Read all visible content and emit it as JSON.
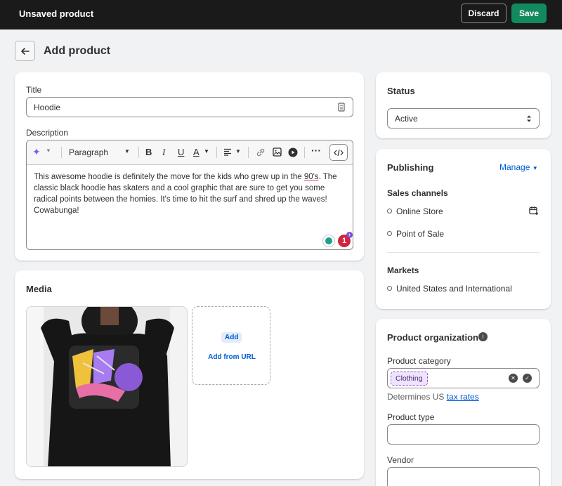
{
  "topbar": {
    "title": "Unsaved product",
    "discard_label": "Discard",
    "save_label": "Save"
  },
  "page": {
    "title": "Add product"
  },
  "product": {
    "title_label": "Title",
    "title_value": "Hoodie",
    "description_label": "Description",
    "toolbar": {
      "paragraph_label": "Paragraph"
    },
    "description": {
      "part1": "This awesome hoodie is definitely the move for the kids who grew up in the ",
      "highlight": "90's",
      "part2": ". The classic black hoodie has skaters and a cool graphic that are sure to get you some radical points between the homies. It's time to hit the surf and shred up the waves! Cowabunga!"
    },
    "grammar_badge_count": "1"
  },
  "media": {
    "heading": "Media",
    "add_label": "Add",
    "add_from_url_label": "Add from URL"
  },
  "status": {
    "heading": "Status",
    "selected": "Active"
  },
  "publishing": {
    "heading": "Publishing",
    "manage_label": "Manage",
    "sales_channels_label": "Sales channels",
    "channels": [
      "Online Store",
      "Point of Sale"
    ],
    "markets_label": "Markets",
    "markets": [
      "United States and International"
    ]
  },
  "organization": {
    "heading": "Product organization",
    "category_label": "Product category",
    "category_tag": "Clothing",
    "tax_note_prefix": "Determines US ",
    "tax_link": "tax rates",
    "type_label": "Product type",
    "vendor_label": "Vendor"
  },
  "colors": {
    "topbar": "#1a1a1a",
    "save": "#138a5e",
    "link": "#005bd3",
    "tag_bg": "#eee4fb"
  }
}
